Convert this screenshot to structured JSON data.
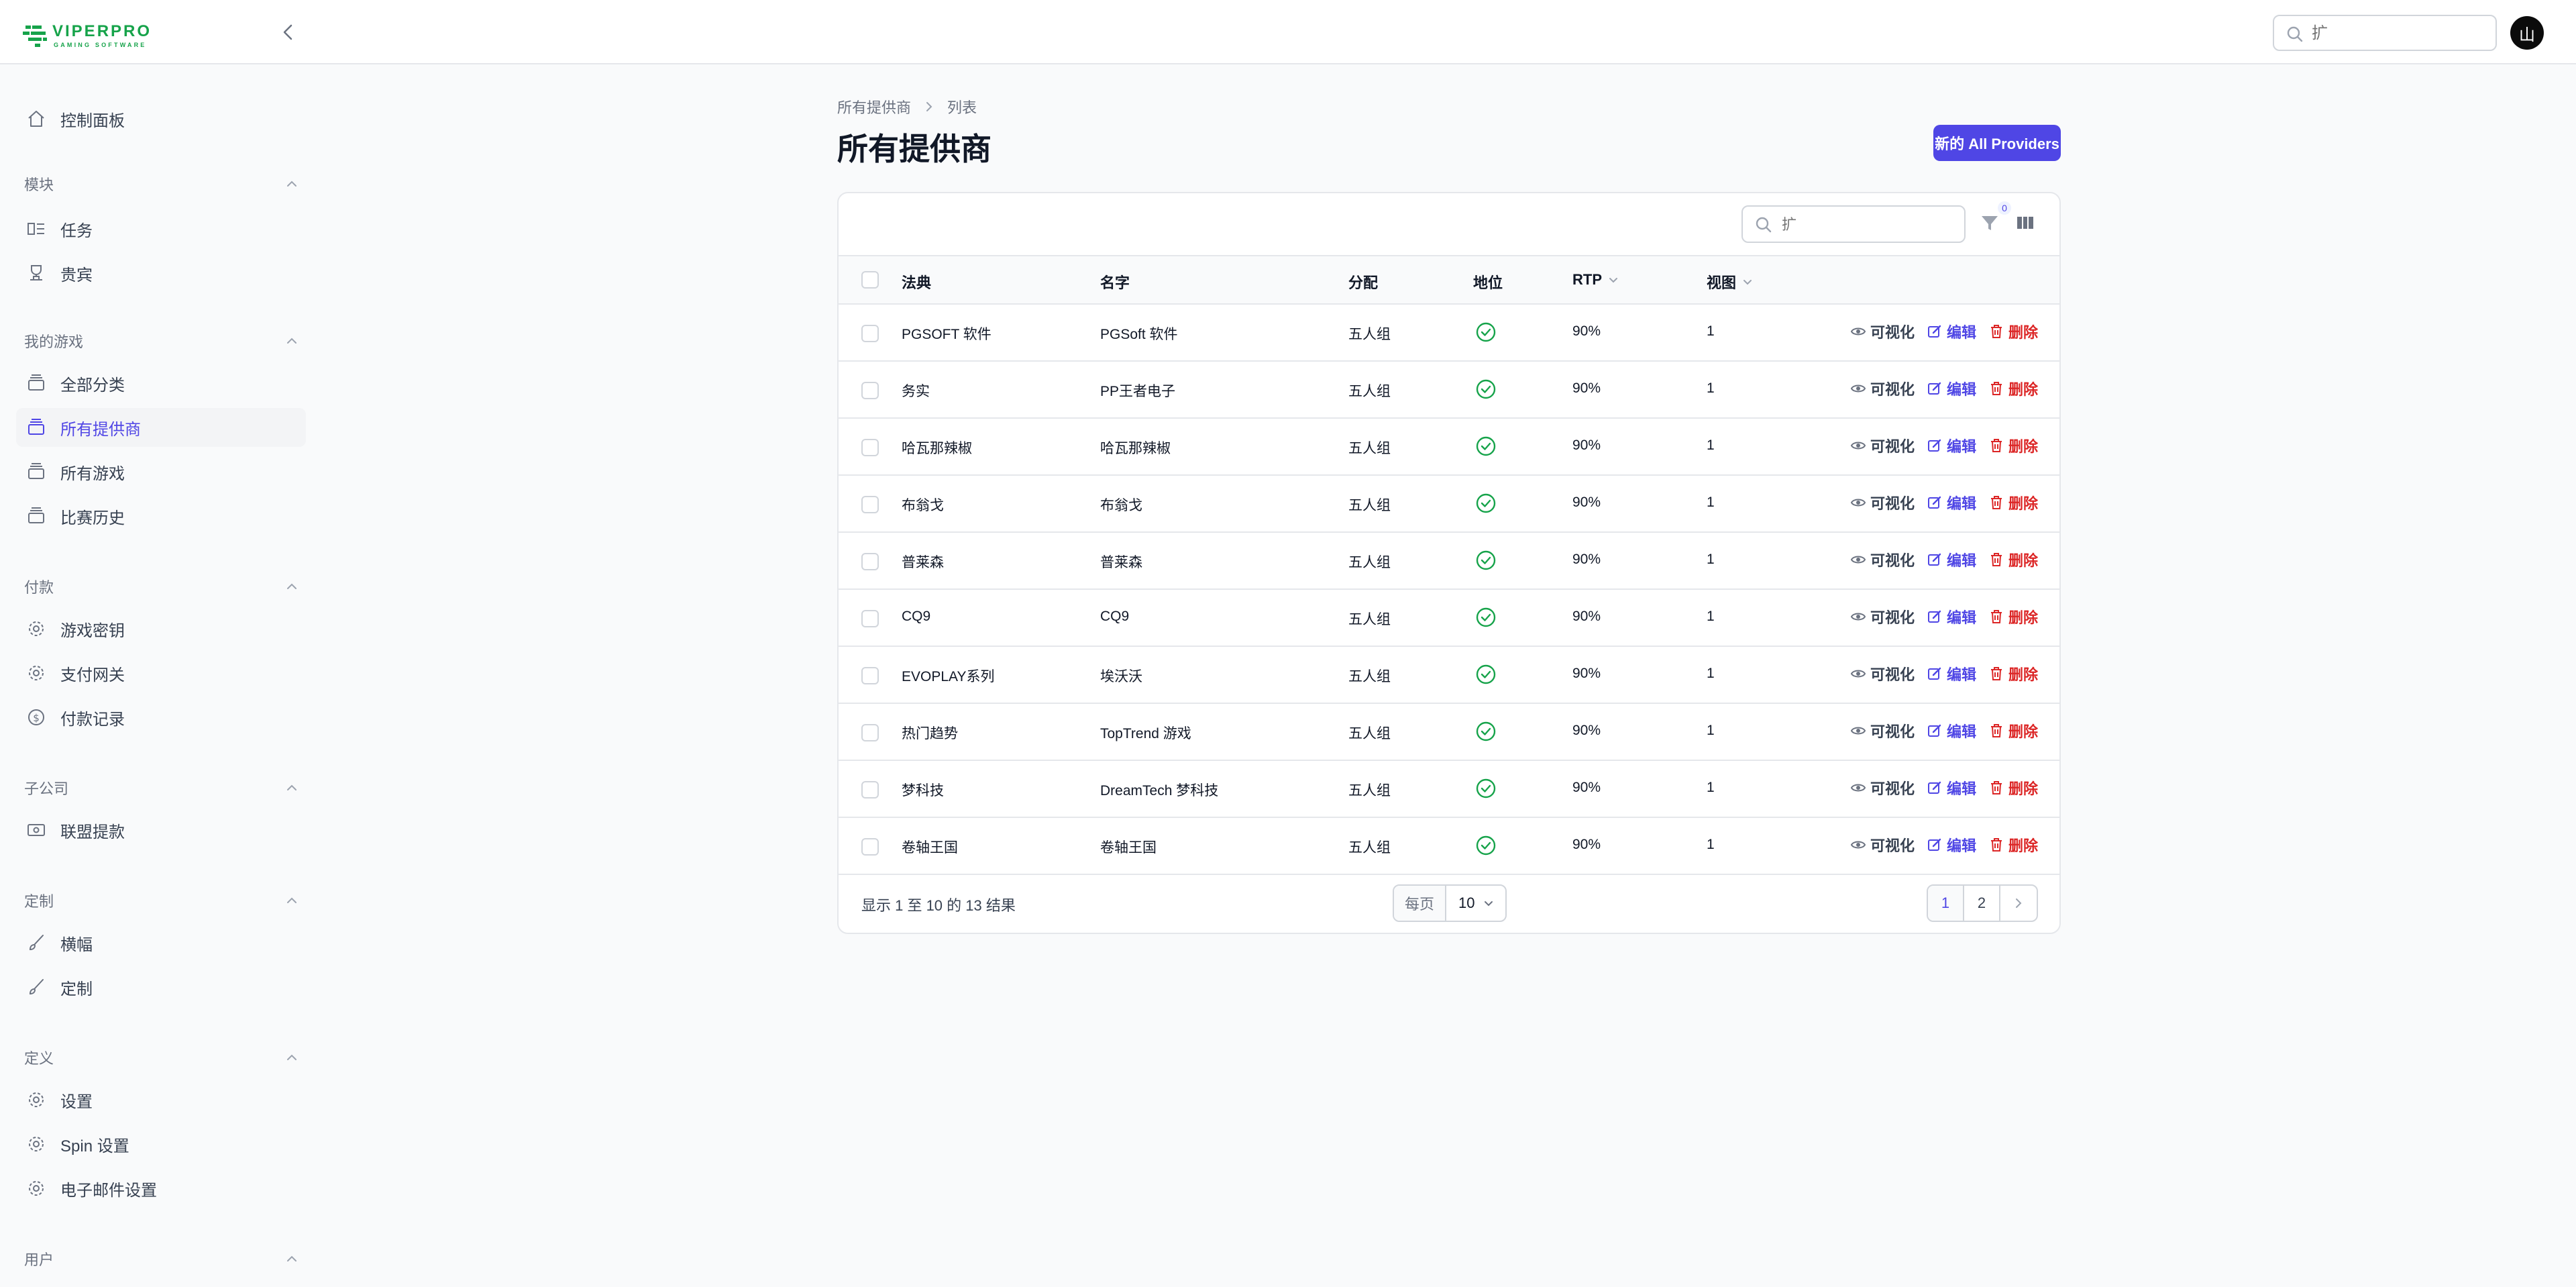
{
  "header": {
    "logo_text": "VIPERPRO",
    "logo_subtext": "GAMING SOFTWARE",
    "search_placeholder": "扩",
    "avatar_initial": "山"
  },
  "sidebar": {
    "dashboard": "控制面板",
    "groups": [
      {
        "label": "模块",
        "items": [
          "任务",
          "贵宾"
        ]
      },
      {
        "label": "我的游戏",
        "items": [
          "全部分类",
          "所有提供商",
          "所有游戏",
          "比赛历史"
        ]
      },
      {
        "label": "付款",
        "items": [
          "游戏密钥",
          "支付网关",
          "付款记录"
        ]
      },
      {
        "label": "子公司",
        "items": [
          "联盟提款"
        ]
      },
      {
        "label": "定制",
        "items": [
          "横幅",
          "定制"
        ]
      },
      {
        "label": "定义",
        "items": [
          "设置",
          "Spin 设置",
          "电子邮件设置"
        ]
      },
      {
        "label": "用户",
        "items": []
      }
    ]
  },
  "breadcrumb": [
    "所有提供商",
    "列表"
  ],
  "page_title": "所有提供商",
  "new_button": "新的 All Providers",
  "table": {
    "search_placeholder": "扩",
    "filter_count": "0",
    "columns": [
      "法典",
      "名字",
      "分配",
      "地位",
      "RTP",
      "视图"
    ],
    "rows": [
      {
        "code": "PGSOFT 软件",
        "name": "PGSoft 软件",
        "distribution": "五人组",
        "rtp": "90%",
        "views": "1"
      },
      {
        "code": "务实",
        "name": "PP王者电子",
        "distribution": "五人组",
        "rtp": "90%",
        "views": "1"
      },
      {
        "code": "哈瓦那辣椒",
        "name": "哈瓦那辣椒",
        "distribution": "五人组",
        "rtp": "90%",
        "views": "1"
      },
      {
        "code": "布翁戈",
        "name": "布翁戈",
        "distribution": "五人组",
        "rtp": "90%",
        "views": "1"
      },
      {
        "code": "普莱森",
        "name": "普莱森",
        "distribution": "五人组",
        "rtp": "90%",
        "views": "1"
      },
      {
        "code": "CQ9",
        "name": "CQ9",
        "distribution": "五人组",
        "rtp": "90%",
        "views": "1"
      },
      {
        "code": "EVOPLAY系列",
        "name": "埃沃沃",
        "distribution": "五人组",
        "rtp": "90%",
        "views": "1"
      },
      {
        "code": "热门趋势",
        "name": "TopTrend 游戏",
        "distribution": "五人组",
        "rtp": "90%",
        "views": "1"
      },
      {
        "code": "梦科技",
        "name": "DreamTech 梦科技",
        "distribution": "五人组",
        "rtp": "90%",
        "views": "1"
      },
      {
        "code": "卷轴王国",
        "name": "卷轴王国",
        "distribution": "五人组",
        "rtp": "90%",
        "views": "1"
      }
    ],
    "actions": {
      "view": "可视化",
      "edit": "编辑",
      "delete": "删除"
    }
  },
  "footer": {
    "summary": "显示 1 至 10 的 13 结果",
    "per_page_label": "每页",
    "per_page_value": "10",
    "pages": [
      "1",
      "2"
    ]
  },
  "colors": {
    "accent": "#4f46e5",
    "danger": "#dc2626",
    "success": "#16a34a",
    "logo": "#16a34a"
  }
}
